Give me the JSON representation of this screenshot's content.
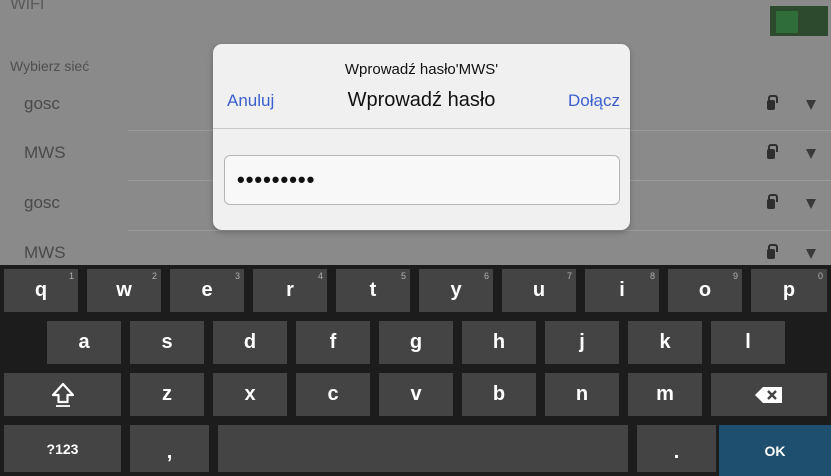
{
  "background": {
    "title": "WiFi",
    "section_header": "Wybierz sieć",
    "networks": [
      "gosc",
      "MWS",
      "gosc",
      "MWS"
    ]
  },
  "dialog": {
    "title": "Wprowadź hasło'MWS'",
    "cancel_label": "Anuluj",
    "subtitle": "Wprowadź hasło",
    "join_label": "Dołącz",
    "password_value": "•••••••••"
  },
  "keyboard": {
    "row1": [
      {
        "label": "q",
        "hint": "1"
      },
      {
        "label": "w",
        "hint": "2"
      },
      {
        "label": "e",
        "hint": "3"
      },
      {
        "label": "r",
        "hint": "4"
      },
      {
        "label": "t",
        "hint": "5"
      },
      {
        "label": "y",
        "hint": "6"
      },
      {
        "label": "u",
        "hint": "7"
      },
      {
        "label": "i",
        "hint": "8"
      },
      {
        "label": "o",
        "hint": "9"
      },
      {
        "label": "p",
        "hint": "0"
      }
    ],
    "row2": [
      "a",
      "s",
      "d",
      "f",
      "g",
      "h",
      "j",
      "k",
      "l"
    ],
    "row3": [
      "z",
      "x",
      "c",
      "v",
      "b",
      "n",
      "m"
    ],
    "symbols_label": "?123",
    "comma_label": ",",
    "period_label": ".",
    "ok_label": "OK",
    "icons": {
      "shift": "shift-icon",
      "backspace": "backspace-icon"
    }
  },
  "colors": {
    "link": "#3c5fd0",
    "ok_key": "#1e4f6e",
    "toggle_on": "#2f6d3a"
  }
}
